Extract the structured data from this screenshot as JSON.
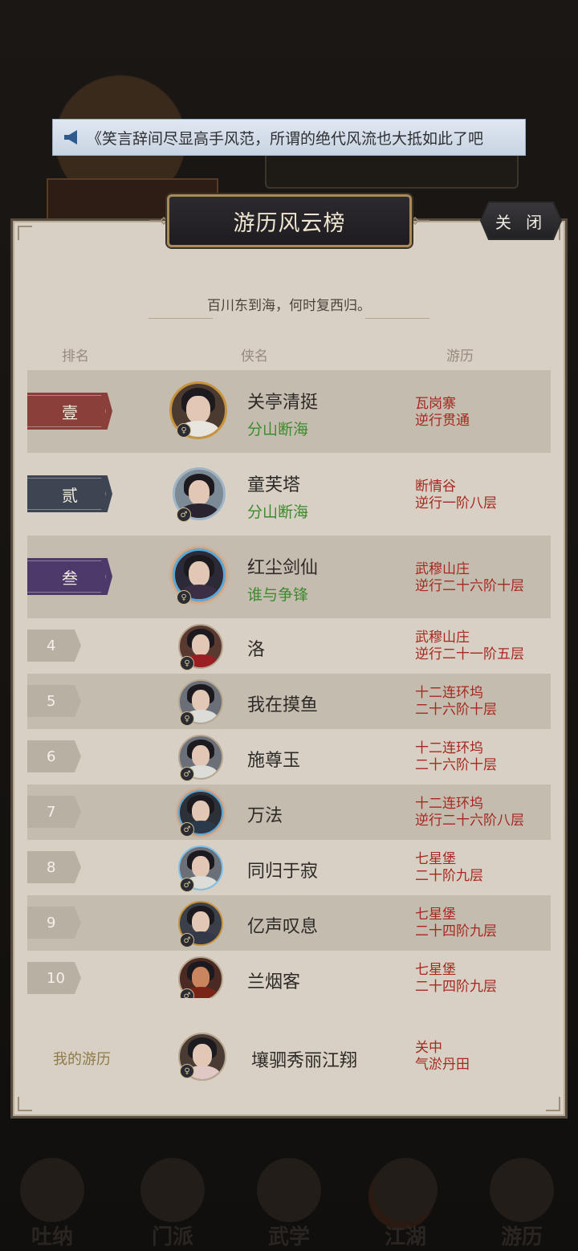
{
  "marquee": {
    "text": "《笑言辞间尽显高手风范，所谓的绝代风流也大抵如此了吧"
  },
  "panel": {
    "title": "游历风云榜",
    "close_label": "关 闭",
    "subtitle": "百川东到海，何时复西归。",
    "headers": {
      "rank": "排名",
      "hero": "侠名",
      "travel": "游历"
    }
  },
  "rankings": [
    {
      "rank": "壹",
      "name": "关亭清挺",
      "title": "分山断海",
      "loc1": "瓦岗寨",
      "loc2": "逆行贯通",
      "tag_color": "#8a3f3b"
    },
    {
      "rank": "贰",
      "name": "童芙塔",
      "title": "分山断海",
      "loc1": "断情谷",
      "loc2": "逆行一阶八层",
      "tag_color": "#3d4452"
    },
    {
      "rank": "叁",
      "name": "红尘剑仙",
      "title": "谁与争锋",
      "loc1": "武穆山庄",
      "loc2": "逆行二十六阶十层",
      "tag_color": "#4d3a6a"
    },
    {
      "rank": "4",
      "name": "洛",
      "loc1": "武穆山庄",
      "loc2": "逆行二十一阶五层"
    },
    {
      "rank": "5",
      "name": "我在摸鱼",
      "loc1": "十二连环坞",
      "loc2": "二十六阶十层"
    },
    {
      "rank": "6",
      "name": "施尊玉",
      "loc1": "十二连环坞",
      "loc2": "二十六阶十层"
    },
    {
      "rank": "7",
      "name": "万法",
      "loc1": "十二连环坞",
      "loc2": "逆行二十六阶八层"
    },
    {
      "rank": "8",
      "name": "同归于寂",
      "loc1": "七星堡",
      "loc2": "二十阶九层"
    },
    {
      "rank": "9",
      "name": "亿声叹息",
      "loc1": "七星堡",
      "loc2": "二十四阶九层"
    },
    {
      "rank": "10",
      "name": "兰烟客",
      "loc1": "七星堡",
      "loc2": "二十四阶九层"
    }
  ],
  "mine": {
    "label": "我的游历",
    "name": "壤驷秀丽江翔",
    "loc1": "关中",
    "loc2": "气淤丹田"
  },
  "bottom_nav": [
    "吐纳",
    "门派",
    "武学",
    "江湖",
    "游历"
  ]
}
